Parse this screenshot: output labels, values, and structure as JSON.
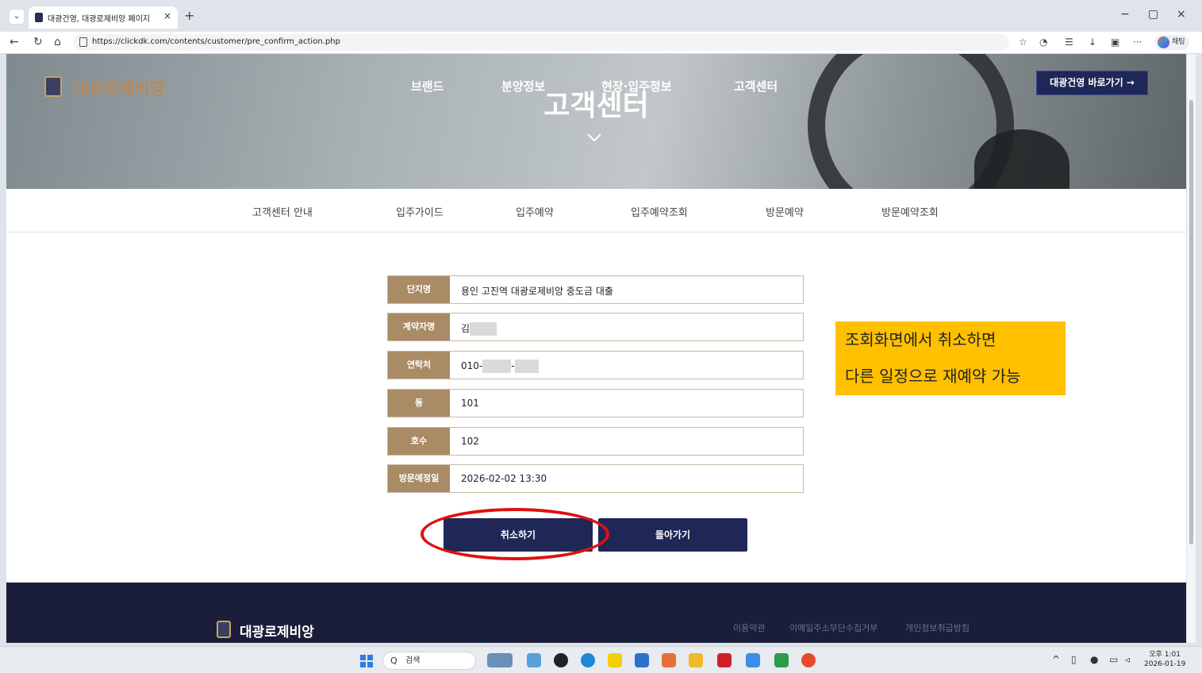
{
  "browser": {
    "tab_title": "대광건영, 대광로제비앙 페이지",
    "tab_close": "×",
    "new_tab": "+",
    "url": "https://clickdk.com/contents/customer/pre_confirm_action.php",
    "profile_label": "채팅",
    "window_controls": [
      "−",
      "▢",
      "×"
    ]
  },
  "header": {
    "logo_text": "대광로제비앙",
    "nav": [
      "브랜드",
      "분양정보",
      "현장·입주정보",
      "고객센터"
    ],
    "hero_title": "고객센터",
    "shortcut_button": "대광건영 바로가기 →"
  },
  "subnav": {
    "items": [
      "고객센터 안내",
      "입주가이드",
      "입주예약",
      "입주예약조회",
      "방문예약",
      "방문예약조회"
    ]
  },
  "reservation": {
    "rows": [
      {
        "label": "단지명",
        "value": "용인 고진역 대광로제비앙 중도금 대출"
      },
      {
        "label": "계약자명",
        "value": "김"
      },
      {
        "label": "연락처",
        "value": "010-"
      },
      {
        "label": "동",
        "value": "101"
      },
      {
        "label": "호수",
        "value": "102"
      },
      {
        "label": "방문예정일",
        "value": "2026-02-02 13:30"
      }
    ],
    "phone_sep": "-",
    "cancel_button": "취소하기",
    "back_button": "돌아가기"
  },
  "annotation": {
    "line1": "조회화면에서 취소하면",
    "line2": "다른 일정으로 재예약 가능",
    "highlight_color": "#ffc000",
    "circle_color": "#e01010"
  },
  "footer": {
    "logo_text": "대광로제비앙",
    "links": [
      "이용약관",
      "이메일주소무단수집거부",
      "개인정보취급방침"
    ]
  },
  "taskbar": {
    "search_placeholder": "검색",
    "clock_time": "오후 1:01",
    "clock_date": "2026-01-19"
  },
  "colors": {
    "navy": "#1f2757",
    "label_brown": "#a98b66",
    "footer_bg": "#1b1e3a"
  }
}
